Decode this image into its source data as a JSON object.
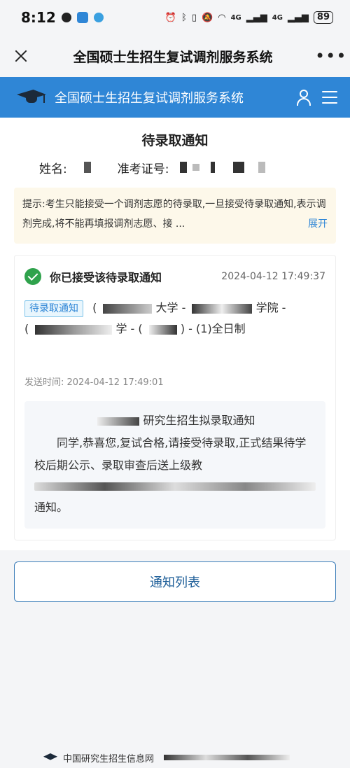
{
  "status_bar": {
    "time": "8:12",
    "battery": "89",
    "network_1": "4G",
    "network_2": "4G"
  },
  "title_bar": {
    "title": "全国硕士生招生复试调剂服务系统"
  },
  "header": {
    "title": "全国硕士生招生复试调剂服务系统",
    "color": "#2f86d6"
  },
  "notice": {
    "title": "待录取通知",
    "name_label": "姓名:",
    "exam_id_label": "准考证号:",
    "tip": "提示:考生只能接受一个调剂志愿的待录取,一旦接受待录取通知,表示调剂完成,将不能再填报调剂志愿、接 ...",
    "tip_expand": "展开"
  },
  "card": {
    "status": "你已接受该待录取通知",
    "time": "2024-04-12 17:49:37",
    "tag": "待录取通知",
    "line1_a": "(",
    "line1_b": "大学 - ",
    "line1_c": "学院 -",
    "line2_a": "(",
    "line2_b": "学 - (",
    "line2_c": ") - (1)全日制",
    "send_time_label": "发送时间: ",
    "send_time": "2024-04-12 17:49:01",
    "message": {
      "title": "研究生招生拟录取通知",
      "body": "同学,恭喜您,复试合格,请接受待录取,正式结果待学校后期公示、录取审查后送上级教",
      "end": "通知。"
    }
  },
  "buttons": {
    "notice_list": "通知列表"
  },
  "footer": {
    "text": "中国研究生招生信息网"
  }
}
